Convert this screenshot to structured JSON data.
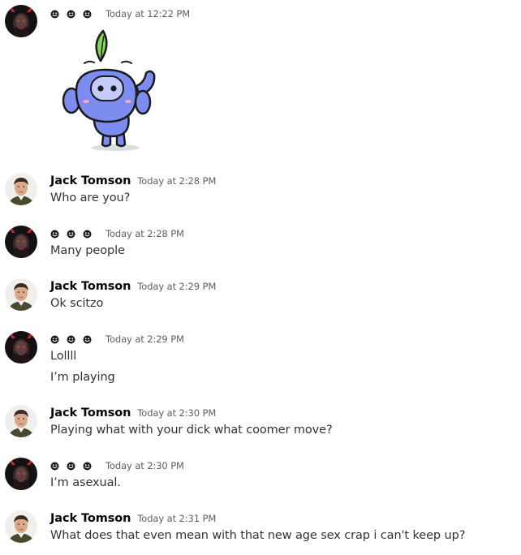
{
  "colors": {
    "username": "#060607",
    "timestamp": "#5c5e66",
    "message_text": "#2e3338",
    "background": "#ffffff",
    "wumpus_body": "#7d8cf0",
    "leaf": "#7fd858"
  },
  "messages": [
    {
      "author": "smiley-name",
      "timestamp": "Today at 12:22 PM",
      "content": [],
      "sticker": "wumpus-waving-sticker"
    },
    {
      "author": "Jack Tomson",
      "timestamp": "Today at 2:28 PM",
      "content": [
        "Who are you?"
      ]
    },
    {
      "author": "smiley-name",
      "timestamp": "Today at 2:28 PM",
      "content": [
        "Many people"
      ]
    },
    {
      "author": "Jack Tomson",
      "timestamp": "Today at 2:29 PM",
      "content": [
        "Ok scitzo"
      ]
    },
    {
      "author": "smiley-name",
      "timestamp": "Today at 2:29 PM",
      "content": [
        "Lollll",
        "I’m playing"
      ]
    },
    {
      "author": "Jack Tomson",
      "timestamp": "Today at 2:30 PM",
      "content": [
        "Playing what with your dick what coomer move?"
      ]
    },
    {
      "author": "smiley-name",
      "timestamp": "Today at 2:30 PM",
      "content": [
        "I’m asexual."
      ]
    },
    {
      "author": "Jack Tomson",
      "timestamp": "Today at 2:31 PM",
      "content": [
        "What does that even mean with that new age sex crap i can't keep up?"
      ]
    }
  ]
}
